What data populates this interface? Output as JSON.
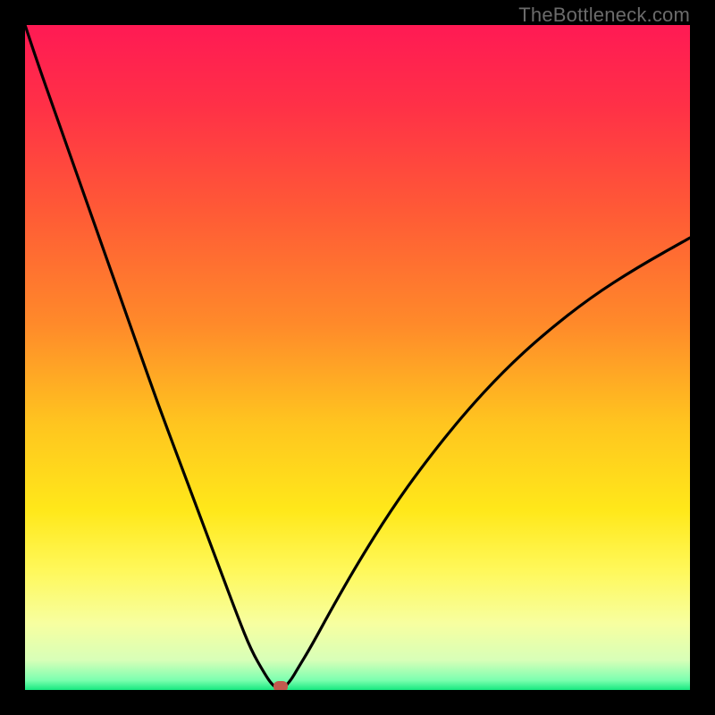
{
  "watermark": "TheBottleneck.com",
  "colors": {
    "black": "#000000",
    "curve": "#000000",
    "marker": "#c15a4e"
  },
  "chart_data": {
    "type": "line",
    "title": "",
    "xlabel": "",
    "ylabel": "",
    "xlim": [
      0,
      100
    ],
    "ylim": [
      0,
      100
    ],
    "grid": false,
    "gradient_stops": [
      {
        "pos": 0.0,
        "color": "#ff1a54"
      },
      {
        "pos": 0.12,
        "color": "#ff3047"
      },
      {
        "pos": 0.28,
        "color": "#ff5a36"
      },
      {
        "pos": 0.45,
        "color": "#ff8a2a"
      },
      {
        "pos": 0.6,
        "color": "#ffc51f"
      },
      {
        "pos": 0.73,
        "color": "#ffe81a"
      },
      {
        "pos": 0.82,
        "color": "#fff85a"
      },
      {
        "pos": 0.9,
        "color": "#f7ffa0"
      },
      {
        "pos": 0.955,
        "color": "#d8ffb8"
      },
      {
        "pos": 0.985,
        "color": "#7dffb0"
      },
      {
        "pos": 1.0,
        "color": "#17e880"
      }
    ],
    "series": [
      {
        "name": "bottleneck-curve",
        "x": [
          0,
          2,
          5,
          8,
          11,
          14,
          17,
          20,
          23,
          26,
          29,
          32,
          34,
          36,
          37,
          37.8,
          38.5,
          39,
          40,
          41,
          43,
          46,
          50,
          55,
          60,
          66,
          72,
          78,
          85,
          92,
          100
        ],
        "y": [
          100,
          94,
          85.5,
          77,
          68.5,
          60,
          51.5,
          43,
          35,
          27,
          19,
          11,
          6,
          2.5,
          1,
          0.3,
          0,
          0.4,
          1.5,
          3.2,
          6.5,
          12,
          19,
          27,
          34,
          41.5,
          48,
          53.5,
          59,
          63.5,
          68
        ]
      }
    ],
    "minimum_point": {
      "x": 38.5,
      "y": 0
    }
  }
}
